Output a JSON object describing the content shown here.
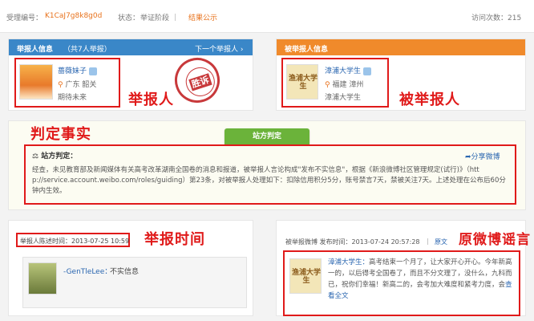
{
  "top": {
    "case_label": "受理编号：",
    "case_id": "K1CaJ7g8k8g0d",
    "status_label": "状态：",
    "status_steps": "举证阶段 ｜",
    "status_current": "结果公示",
    "visits": "访问次数：215"
  },
  "reporter": {
    "header": "举报人信息",
    "header_count": "（共7人举报）",
    "next": "下一个举报人 ›",
    "name": "蔷薇妹子",
    "location": "广东 韶关",
    "bio": "期待未来",
    "stamp_text": "胜诉",
    "annotation": "举报人"
  },
  "reported": {
    "header": "被举报人信息",
    "avatar_text": "渔浦大学生",
    "name": "漳浦大学生",
    "location": "福建 漳州",
    "bio": "漳浦大学生",
    "annotation": "被举报人"
  },
  "verdict": {
    "annotation": "判定事实",
    "tab": "站方判定",
    "title": "站方判定：",
    "share": "分享微博",
    "body": "经查，未见教育部及新闻媒体有关高考改革湖南全国卷的消息和报道，被举报人言论构成\"发布不实信息\"，根据《新浪微博社区管理规定(试行)》（htt p://service.account.weibo.com/roles/guiding）第23条，对被举报人处理如下：扣除信用积分5分，账号禁言7天，禁被关注7天。上述处理在公布后60分钟内生效。"
  },
  "report": {
    "time_label": "举报人陈述时间：2013-07-25 10:59",
    "annotation": "举报时间",
    "user": "-GenTleLee：",
    "claim": "不实信息"
  },
  "original": {
    "meta_label": "被举报微博  发布时间：2013-07-24 20:57:28",
    "sep": "|",
    "original_link": "原文",
    "annotation": "原微博谣言",
    "author": "漳浦大学生：",
    "body": "高考结束一个月了，让大家开心开心。今年新高一的，以后得考全国卷了，而且不分文理了，没什么，九科而已，祝你们幸福！新高二的，会考加大难度和紧考力度，会",
    "more": "查看全文"
  }
}
